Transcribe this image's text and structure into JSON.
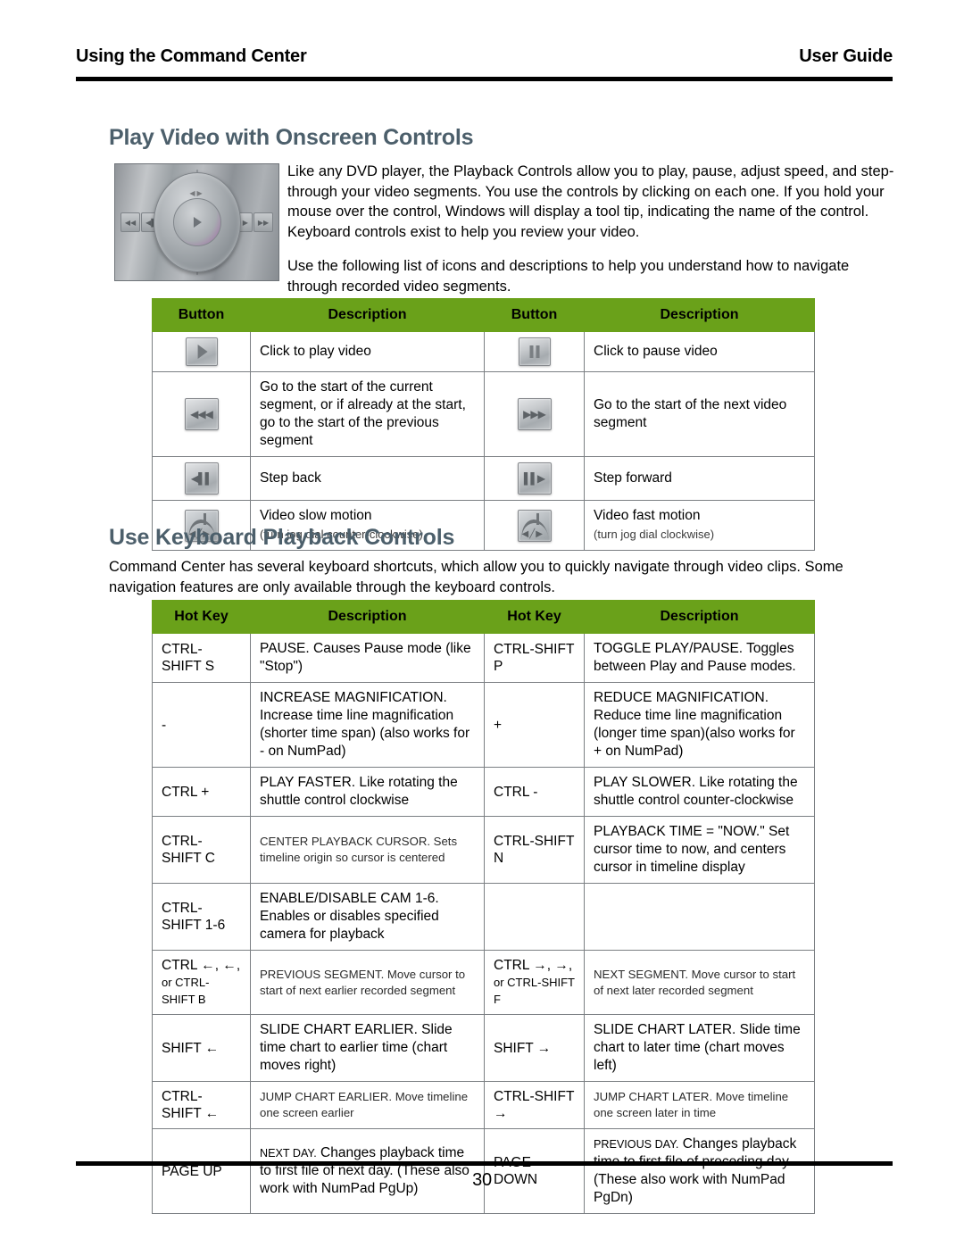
{
  "header": {
    "left_title": "Using the Command Center",
    "right_title": "User Guide"
  },
  "footer": {
    "page_number": "30"
  },
  "theme": {
    "table_header_green": "#6aa11a",
    "heading_slate": "#4c5f6b",
    "rule_black": "#000000"
  },
  "sections": {
    "play_video": {
      "title": "Play Video with Onscreen Controls",
      "image_alt": "jog-shuttle-playback-control",
      "paragraph_1": "Like any DVD player, the Playback Controls allow you to play, pause, adjust speed, and step-through your video segments. You use the controls by clicking on each one. If you hold your mouse over the control, Windows will display a tool tip, indicating the name of the control. Keyboard controls exist to help you review your video.",
      "paragraph_2": "Use the following list of icons and descriptions to help you understand how to navigate through recorded video segments."
    },
    "keyboard": {
      "title": "Use Keyboard Playback Controls",
      "paragraph_1": "Command Center has several keyboard shortcuts, which allow you to quickly navigate through video clips. Some navigation features are only available through the keyboard controls."
    }
  },
  "button_table": {
    "headers": [
      "Button",
      "Description",
      "Button",
      "Description"
    ],
    "rows": [
      {
        "left_icon": "play-button-icon",
        "left_desc": "Click to play video",
        "left_sub": "",
        "right_icon": "pause-button-icon",
        "right_desc": "Click to pause video",
        "right_sub": ""
      },
      {
        "left_icon": "previous-segment-button-icon",
        "left_desc": "Go to the start of the current segment, or if already at the start, go to the start of the previous segment",
        "left_sub": "",
        "right_icon": "next-segment-button-icon",
        "right_desc": "Go to the start of the next video segment",
        "right_sub": ""
      },
      {
        "left_icon": "step-back-button-icon",
        "left_desc": "Step back",
        "left_sub": "",
        "right_icon": "step-forward-button-icon",
        "right_desc": "Step forward",
        "right_sub": ""
      },
      {
        "left_icon": "slow-motion-jog-icon",
        "left_desc": "Video slow motion",
        "left_sub": "(turn jog dial counter-clockwise)",
        "right_icon": "fast-motion-jog-icon",
        "right_desc": "Video fast motion",
        "right_sub": "(turn jog dial clockwise)"
      }
    ]
  },
  "hotkey_table": {
    "headers": [
      "Hot Key",
      "Description",
      "Hot Key",
      "Description"
    ],
    "rows": [
      {
        "left_key": "CTRL-SHIFT S",
        "left_key_small": "",
        "left_desc": "PAUSE. Causes Pause mode (like \"Stop\")",
        "left_style": "normal",
        "right_key": "CTRL-SHIFT P",
        "right_key_small": "",
        "right_desc": "TOGGLE PLAY/PAUSE.  Toggles between Play and Pause modes.",
        "right_style": "normal"
      },
      {
        "left_key": "-",
        "left_key_small": "",
        "left_desc": "INCREASE MAGNIFICATION.  Increase time line magnification (shorter time span) (also works for - on NumPad)",
        "left_style": "normal",
        "right_key": "+",
        "right_key_small": "",
        "right_desc": "REDUCE MAGNIFICATION.  Reduce time line magnification (longer time span)(also works for + on NumPad)",
        "right_style": "normal"
      },
      {
        "left_key": "CTRL +",
        "left_key_small": "",
        "left_desc": "PLAY FASTER. Like rotating the shuttle control clockwise",
        "left_style": "normal",
        "right_key": "CTRL -",
        "right_key_small": "",
        "right_desc": "PLAY SLOWER.  Like rotating the shuttle control counter-clockwise",
        "right_style": "normal"
      },
      {
        "left_key": "CTRL-SHIFT C",
        "left_key_small": "",
        "left_desc": "CENTER PLAYBACK CURSOR. Sets timeline origin so cursor is centered",
        "left_style": "tiny",
        "right_key": "CTRL-SHIFT N",
        "right_key_small": "",
        "right_desc": "PLAYBACK TIME = \"NOW.\" Set cursor time to now, and centers cursor in timeline display",
        "right_style": "normal"
      },
      {
        "left_key": "CTRL-SHIFT 1-6",
        "left_key_small": "",
        "left_desc": "ENABLE/DISABLE CAM 1-6. Enables or disables specified camera for playback",
        "left_style": "normal",
        "right_key": "",
        "right_key_small": "",
        "right_desc": "",
        "right_style": "normal"
      },
      {
        "left_key": "CTRL ←, ←,",
        "left_key_small": "or CTRL-SHIFT B",
        "left_desc": "PREVIOUS SEGMENT. Move cursor to start of next earlier recorded segment",
        "left_style": "tiny",
        "right_key": "CTRL →, →,",
        "right_key_small": "or CTRL-SHIFT F",
        "right_desc": "NEXT SEGMENT. Move cursor to start of next later recorded segment",
        "right_style": "tiny"
      },
      {
        "left_key": "SHIFT ←",
        "left_key_small": "",
        "left_desc": "SLIDE CHART EARLIER.  Slide time chart to earlier time (chart moves right)",
        "left_style": "normal",
        "right_key": "SHIFT →",
        "right_key_small": "",
        "right_desc": "SLIDE CHART LATER.  Slide time chart to later time (chart moves left)",
        "right_style": "normal"
      },
      {
        "left_key": "CTRL-SHIFT ←",
        "left_key_small": "",
        "left_desc": "JUMP CHART EARLIER. Move timeline one screen earlier",
        "left_style": "tiny",
        "right_key": "CTRL-SHIFT →",
        "right_key_small": "",
        "right_desc": "JUMP CHART LATER. Move timeline one screen later in time",
        "right_style": "tiny"
      },
      {
        "left_key": "PAGE UP",
        "left_key_small": "",
        "left_desc_lead": "NEXT DAY.",
        "left_desc": " Changes playback time to first file of next day. (These also work with NumPad PgUp)",
        "left_style": "normal",
        "right_key": "PAGE DOWN",
        "right_key_small": "",
        "right_desc_lead": "PREVIOUS DAY.",
        "right_desc": " Changes playback time to first file of preceding day. (These also work with NumPad PgDn)",
        "right_style": "normal"
      }
    ]
  }
}
